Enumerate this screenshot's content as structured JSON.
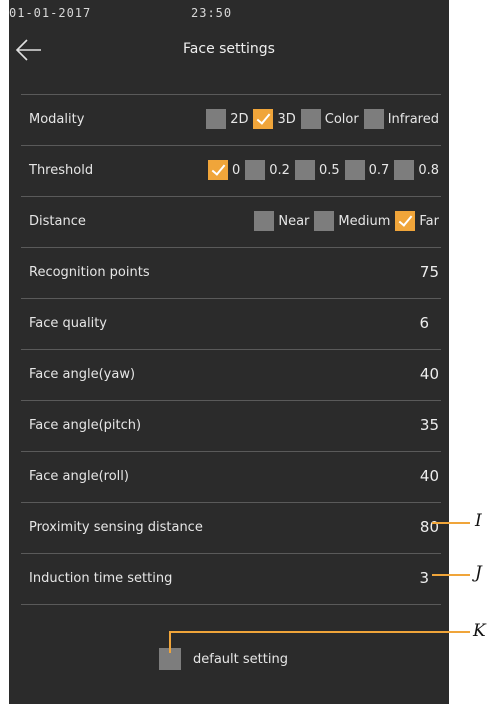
{
  "status_bar": {
    "date": "01-01-2017",
    "time": "23:50"
  },
  "header": {
    "back_icon": "arrow-left-icon",
    "title": "Face settings"
  },
  "settings": {
    "modality": {
      "label": "Modality",
      "options": [
        {
          "label": "2D",
          "checked": false
        },
        {
          "label": "3D",
          "checked": true
        },
        {
          "label": "Color",
          "checked": false
        },
        {
          "label": "Infrared",
          "checked": false
        }
      ]
    },
    "threshold": {
      "label": "Threshold",
      "options": [
        {
          "label": "0",
          "checked": true
        },
        {
          "label": "0.2",
          "checked": false
        },
        {
          "label": "0.5",
          "checked": false
        },
        {
          "label": "0.7",
          "checked": false
        },
        {
          "label": "0.8",
          "checked": false
        }
      ]
    },
    "distance": {
      "label": "Distance",
      "options": [
        {
          "label": "Near",
          "checked": false
        },
        {
          "label": "Medium",
          "checked": false
        },
        {
          "label": "Far",
          "checked": true
        }
      ]
    },
    "recognition_points": {
      "label": "Recognition points",
      "value": "75"
    },
    "face_quality": {
      "label": "Face quality",
      "value": "6"
    },
    "face_angle_yaw": {
      "label": "Face angle(yaw)",
      "value": "40"
    },
    "face_angle_pitch": {
      "label": "Face angle(pitch)",
      "value": "35"
    },
    "face_angle_roll": {
      "label": "Face angle(roll)",
      "value": "40"
    },
    "proximity_distance": {
      "label": "Proximity sensing distance",
      "value": "80"
    },
    "induction_time": {
      "label": "Induction time setting",
      "value": "3"
    }
  },
  "default_setting": {
    "label": "default setting",
    "checked": false
  },
  "callouts": {
    "i": "I",
    "j": "J",
    "k": "K"
  },
  "colors": {
    "background": "#2b2b2b",
    "accent": "#f0a53a",
    "checkbox_off": "#7d7d7d",
    "divider": "#5a5a5a"
  }
}
